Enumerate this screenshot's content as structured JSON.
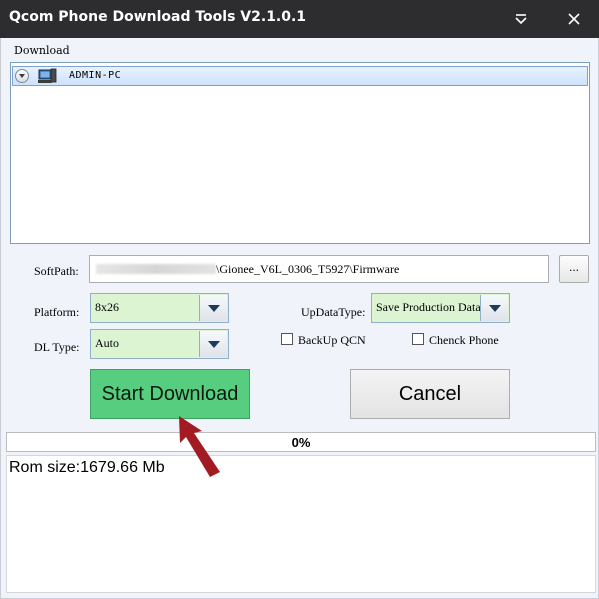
{
  "window": {
    "title": "Qcom Phone Download Tools V2.1.0.1",
    "menu_icon": "chevron-down-icon",
    "close_icon": "close-icon"
  },
  "menu": {
    "download_label": "Download"
  },
  "devices": [
    {
      "name": "ADMIN-PC",
      "icon": "computer-icon"
    }
  ],
  "softpath": {
    "label": "SoftPath:",
    "value": "\\Gionee_V6L_0306_T5927\\Firmware",
    "browse_label": "..."
  },
  "platform": {
    "label": "Platform:",
    "value": "8x26"
  },
  "dl_type": {
    "label": "DL Type:",
    "value": "Auto"
  },
  "updata_type": {
    "label": "UpDataType:",
    "value": "Save Production Data"
  },
  "options": {
    "backup_qcn": {
      "label": "BackUp QCN",
      "checked": false
    },
    "check_phone": {
      "label": "Chenck Phone",
      "checked": false
    }
  },
  "actions": {
    "start_label": "Start Download",
    "cancel_label": "Cancel"
  },
  "progress": {
    "text": "0%",
    "fraction": 0
  },
  "log": {
    "text": "Rom size:1679.66 Mb"
  },
  "colors": {
    "titlebar": "#2d2d30",
    "start_button": "#57cd7f",
    "combo_background": "#dcf4d2",
    "annotation_arrow": "#a21a22"
  }
}
